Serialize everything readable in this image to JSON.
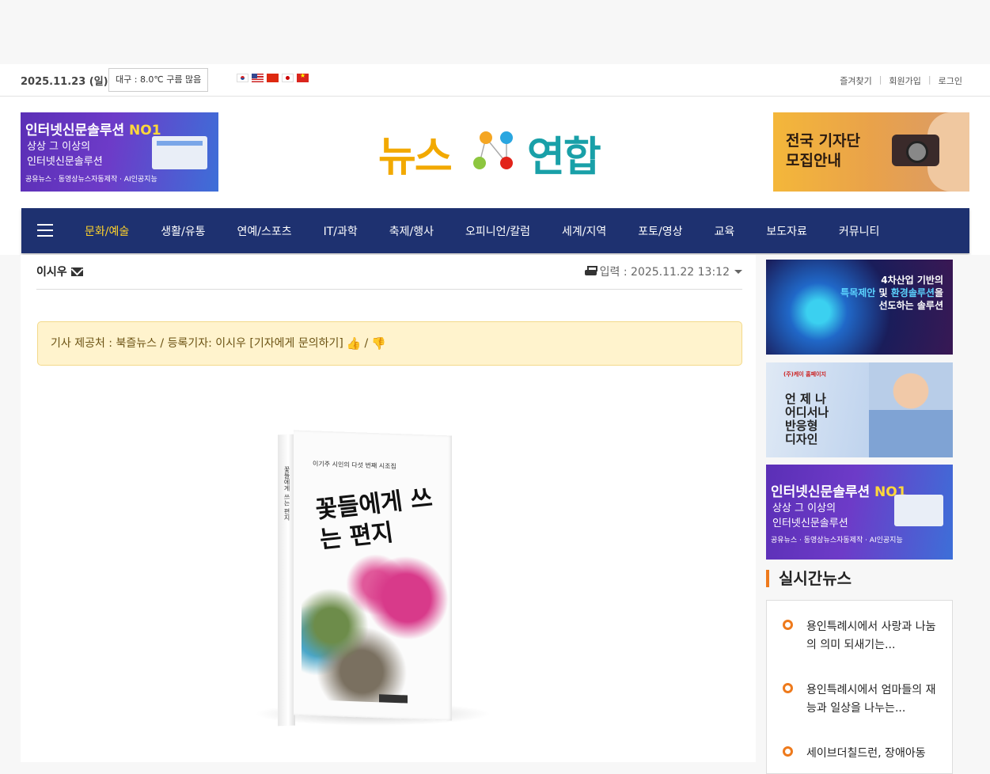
{
  "util_bar": {
    "date": "2025.11.23 (일)",
    "weather": "대구 : 8.0℃ 구름 많음",
    "flags": [
      "kr-flag-icon",
      "us-flag-icon",
      "cn-flag-icon",
      "jp-flag-icon",
      "vn-flag-icon"
    ],
    "links": [
      "즐겨찾기",
      "회원가입",
      "로그인"
    ]
  },
  "header": {
    "left_banner": {
      "line1": "인터넷신문솔루션",
      "line1_highlight": "NO1",
      "line2": "상상 그 이상의",
      "line3": "인터넷신문솔루션",
      "line4": "공유뉴스 · 동영상뉴스자동제작 · AI인공지능"
    },
    "logo": {
      "part1": "뉴스",
      "part2": "연합"
    },
    "right_banner": {
      "line1": "전국 기자단",
      "line2": "모집안내"
    }
  },
  "nav": {
    "items": [
      "문화/예술",
      "생활/유통",
      "연예/스포츠",
      "IT/과학",
      "축제/행사",
      "오피니언/칼럼",
      "세계/지역",
      "포토/영상",
      "교육",
      "보도자료",
      "커뮤니티"
    ],
    "active": "문화/예술"
  },
  "article": {
    "author": "이시우",
    "date_info": "입력 : 2025.11.22 13:12",
    "notice": "기사 제공처 : 북즐뉴스 / 등록기자: 이시우 [기자에게 문의하기]",
    "notice_slash": "/",
    "book": {
      "subtitle": "이기주 시인의 다섯 번째 시조집",
      "title": "꽃들에게 쓰는 편지",
      "spine": "꽃들에게 쓰는 편지"
    }
  },
  "sidebar": {
    "banner1": {
      "line1": "4차산업 기반의",
      "line2_highlight": "특목제안",
      "line2_mid": "및",
      "line2_highlight2": "환경솔루션",
      "line2_end": "을",
      "line3": "선도하는 솔루션"
    },
    "banner2": {
      "brand": "(주)케이 홈페이지",
      "text1": "언 제 나",
      "text2": "어디서나",
      "text3": "반응형",
      "text4": "디자인"
    },
    "banner3": {
      "line1": "인터넷신문솔루션",
      "line1_highlight": "NO1",
      "line2": "상상 그 이상의",
      "line3": "인터넷신문솔루션",
      "line4": "공유뉴스 · 동영상뉴스자동제작 · AI인공지능"
    },
    "live_title": "실시간뉴스",
    "live_news": [
      "용인특례시에서 사랑과 나눔의 의미 되새기는...",
      "용인특례시에서 엄마들의 재능과 일상을 나누는...",
      "세이브더칠드런, 장애아동"
    ]
  }
}
